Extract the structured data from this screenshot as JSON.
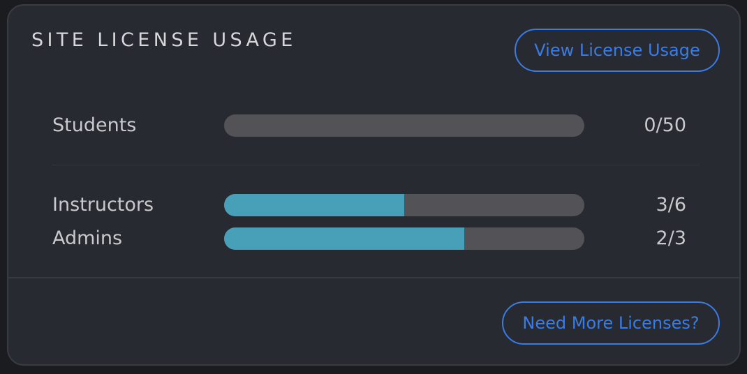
{
  "card": {
    "title": "SITE LICENSE USAGE",
    "view_button_label": "View License Usage",
    "more_button_label": "Need More Licenses?"
  },
  "rows": [
    {
      "label": "Students",
      "count_text": "0/50",
      "used": 0,
      "total": 50
    },
    {
      "label": "Instructors",
      "count_text": "3/6",
      "used": 3,
      "total": 6
    },
    {
      "label": "Admins",
      "count_text": "2/3",
      "used": 2,
      "total": 3
    }
  ],
  "colors": {
    "bar_fill": "#47a0b8",
    "bar_track": "#535257",
    "accent": "#3a7ce5"
  }
}
